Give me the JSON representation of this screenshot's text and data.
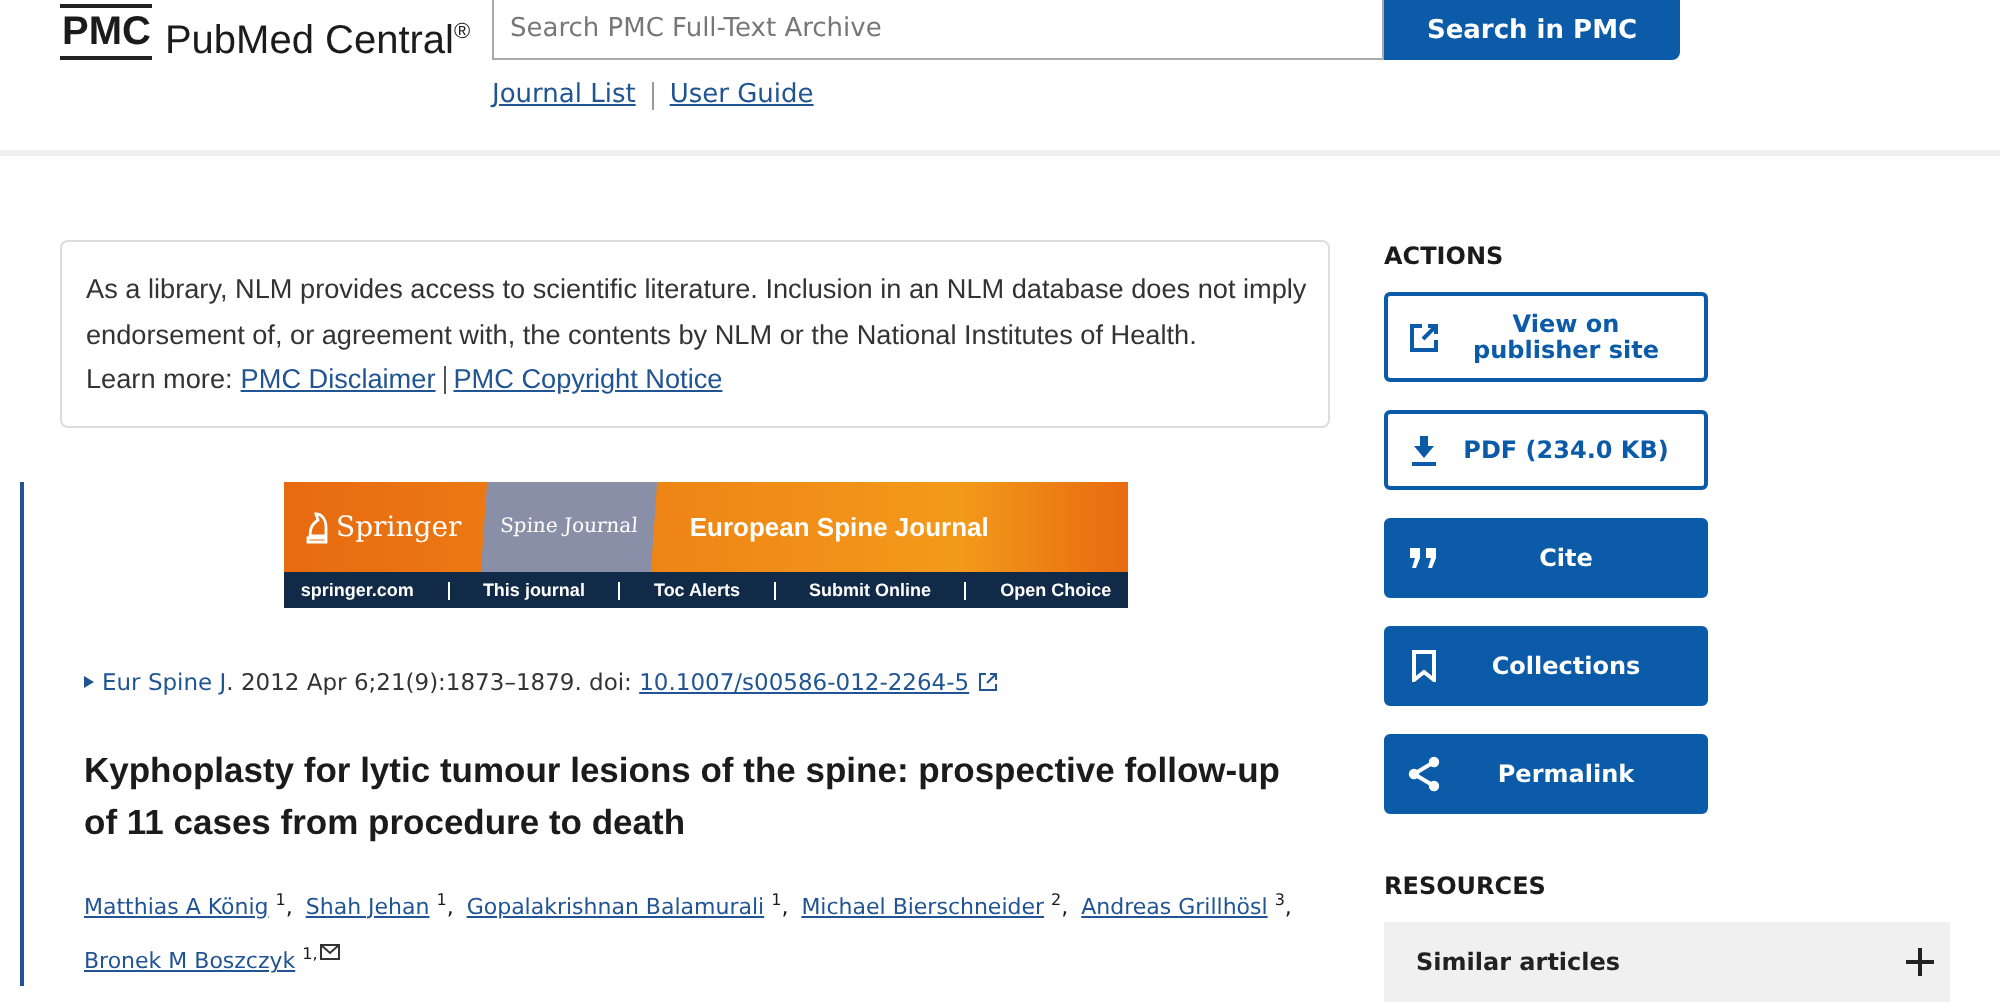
{
  "header": {
    "logo_mark": "PMC",
    "logo_text": "PubMed Central",
    "logo_reg": "®",
    "search": {
      "placeholder": "Search PMC Full-Text Archive"
    },
    "search_button": "Search in PMC",
    "links": [
      {
        "label": "Journal List"
      },
      {
        "label": "User Guide"
      }
    ]
  },
  "notice": {
    "text": "As a library, NLM provides access to scientific literature. Inclusion in an NLM database does not imply endorsement of, or agreement with, the contents by NLM or the National Institutes of Health.",
    "learn_more": "Learn more:",
    "links": [
      {
        "label": "PMC Disclaimer"
      },
      {
        "label": "PMC Copyright Notice"
      }
    ]
  },
  "banner": {
    "publisher": "Springer",
    "cover": "Spine Journal",
    "journal": "European Spine Journal",
    "links": [
      "springer.com",
      "This journal",
      "Toc Alerts",
      "Submit Online",
      "Open Choice"
    ]
  },
  "citation": {
    "journal": "Eur Spine J",
    "details": ". 2012 Apr 6;21(9):1873–1879. doi: ",
    "doi": "10.1007/s00586-012-2264-5"
  },
  "title": "Kyphoplasty for lytic tumour lesions of the spine: prospective follow-up of 11 cases from procedure to death",
  "authors": [
    {
      "name": "Matthias A König",
      "affiliation": "1",
      "corresponding": false,
      "separator": ","
    },
    {
      "name": "Shah Jehan",
      "affiliation": "1",
      "corresponding": false,
      "separator": ","
    },
    {
      "name": "Gopalakrishnan Balamurali",
      "affiliation": "1",
      "corresponding": false,
      "separator": ","
    },
    {
      "name": "Michael Bierschneider",
      "affiliation": "2",
      "corresponding": false,
      "separator": ","
    },
    {
      "name": "Andreas Grillhösl",
      "affiliation": "3",
      "corresponding": false,
      "separator": ","
    },
    {
      "name": "Bronek M Boszczyk",
      "affiliation": "1,",
      "corresponding": true
    }
  ],
  "actions": {
    "heading": "ACTIONS",
    "buttons": [
      {
        "label": "View on publisher site",
        "kind": "external"
      },
      {
        "label": "PDF (234.0 KB)",
        "kind": "download"
      },
      {
        "label": "Cite",
        "kind": "quote"
      },
      {
        "label": "Collections",
        "kind": "bookmark"
      },
      {
        "label": "Permalink",
        "kind": "share"
      }
    ]
  },
  "resources": {
    "heading": "RESOURCES",
    "items": [
      {
        "label": "Similar articles",
        "expanded": false
      }
    ]
  }
}
